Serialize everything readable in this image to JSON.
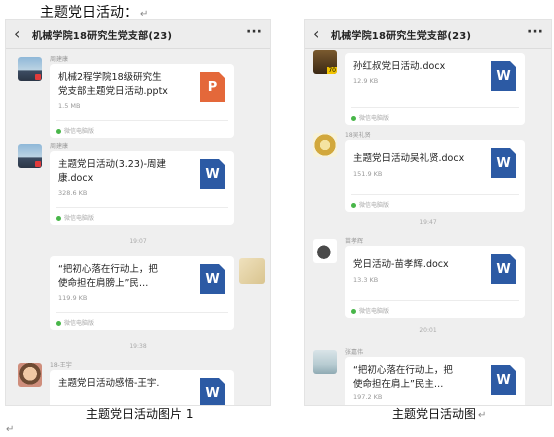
{
  "doc": {
    "heading": "主题党日活动：",
    "return_mark": "↵",
    "caption_left": "主题党日活动图片 1",
    "caption_right": "主题党日活动图",
    "bottom_mark": "↵"
  },
  "left": {
    "title": "机械学院18研究生党支部(23)",
    "back_icon": "‹",
    "more_icon": "···",
    "messages": [
      {
        "sender": "周建康",
        "file_name": "机械2程学院18级研究生\n党支部主题党日活动.pptx",
        "file_size": "1.5 MB",
        "file_type": "P",
        "file_icon": "ppt-icon",
        "source": "微信电脑版"
      },
      {
        "sender": "周建康",
        "file_name": "主题党日活动(3.23)-周建\n康.docx",
        "file_size": "328.6 KB",
        "file_type": "W",
        "file_icon": "word-icon",
        "source": "微信电脑版"
      },
      {
        "time": "19:07",
        "file_name": "“把初心落在行动上，把\n使命担在肩膀上”民…",
        "file_size": "119.9 KB",
        "file_type": "W",
        "file_icon": "word-icon",
        "source": "微信电脑版"
      },
      {
        "time": "19:38",
        "sender": "18-王宇",
        "file_name": "主题党日活动感悟-王宇.",
        "file_type": "W",
        "file_icon": "word-icon"
      }
    ]
  },
  "right": {
    "title": "机械学院18研究生党支部(23)",
    "back_icon": "‹",
    "more_icon": "···",
    "messages": [
      {
        "file_name": "孙红叔党日活动.docx",
        "file_size": "12.9 KB",
        "file_type": "W",
        "file_icon": "word-icon",
        "source": "微信电脑版"
      },
      {
        "sender": "18吴礼贤",
        "file_name": "主题党日活动吴礼贤.docx",
        "file_size": "151.9 KB",
        "file_type": "W",
        "file_icon": "word-icon",
        "source": "微信电脑版"
      },
      {
        "time": "19:47",
        "sender": "苗孝辉",
        "file_name": "党日活动-苗孝辉.docx",
        "file_size": "13.3 KB",
        "file_type": "W",
        "file_icon": "word-icon",
        "source": "微信电脑版"
      },
      {
        "time": "20:01",
        "sender": "张嘉伟",
        "file_name": "“把初心落在行动上，把\n使命担在肩上”民主…",
        "file_size": "197.2 KB",
        "file_type": "W",
        "file_icon": "word-icon"
      }
    ]
  }
}
